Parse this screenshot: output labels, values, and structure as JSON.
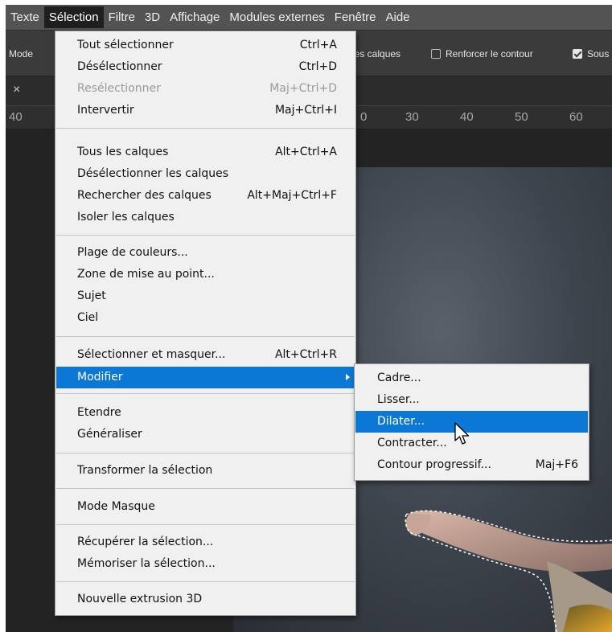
{
  "menubar": {
    "items": [
      {
        "label": "Texte"
      },
      {
        "label": "Sélection"
      },
      {
        "label": "Filtre"
      },
      {
        "label": "3D"
      },
      {
        "label": "Affichage"
      },
      {
        "label": "Modules externes"
      },
      {
        "label": "Fenêtre"
      },
      {
        "label": "Aide"
      }
    ]
  },
  "options": {
    "mode_label": "Mode",
    "calques_label": "les calques",
    "renforcer_label": "Renforcer le contour",
    "renforcer_checked": false,
    "sous_label": "Sous",
    "sous_checked": true
  },
  "tab": {
    "close_glyph": "×"
  },
  "ruler": {
    "left_value": "40",
    "ticks": [
      "0",
      "30",
      "40",
      "50",
      "60"
    ]
  },
  "selection_menu": {
    "items": [
      {
        "label": "Tout sélectionner",
        "shortcut": "Ctrl+A"
      },
      {
        "label": "Désélectionner",
        "shortcut": "Ctrl+D"
      },
      {
        "label": "Resélectionner",
        "shortcut": "Maj+Ctrl+D",
        "disabled": true
      },
      {
        "label": "Intervertir",
        "shortcut": "Maj+Ctrl+I"
      },
      {
        "label": "Tous les calques",
        "shortcut": "Alt+Ctrl+A"
      },
      {
        "label": "Désélectionner les calques",
        "shortcut": ""
      },
      {
        "label": "Rechercher des calques",
        "shortcut": "Alt+Maj+Ctrl+F"
      },
      {
        "label": "Isoler les calques",
        "shortcut": ""
      },
      {
        "label": "Plage de couleurs...",
        "shortcut": ""
      },
      {
        "label": "Zone de mise au point...",
        "shortcut": ""
      },
      {
        "label": "Sujet",
        "shortcut": ""
      },
      {
        "label": "Ciel",
        "shortcut": ""
      },
      {
        "label": "Sélectionner et masquer...",
        "shortcut": "Alt+Ctrl+R"
      },
      {
        "label": "Modifier",
        "shortcut": "",
        "submenu": true,
        "highlighted": true
      },
      {
        "label": "Etendre",
        "shortcut": ""
      },
      {
        "label": "Généraliser",
        "shortcut": ""
      },
      {
        "label": "Transformer la sélection",
        "shortcut": ""
      },
      {
        "label": "Mode Masque",
        "shortcut": ""
      },
      {
        "label": "Récupérer la sélection...",
        "shortcut": ""
      },
      {
        "label": "Mémoriser la sélection...",
        "shortcut": ""
      },
      {
        "label": "Nouvelle extrusion 3D",
        "shortcut": ""
      }
    ]
  },
  "modify_submenu": {
    "items": [
      {
        "label": "Cadre...",
        "shortcut": ""
      },
      {
        "label": "Lisser...",
        "shortcut": ""
      },
      {
        "label": "Dilater...",
        "shortcut": "",
        "highlighted": true
      },
      {
        "label": "Contracter...",
        "shortcut": ""
      },
      {
        "label": "Contour progressif...",
        "shortcut": "Maj+F6"
      }
    ]
  },
  "colors": {
    "highlight": "#0a78d4",
    "menu_bg": "#f0f0f0",
    "menubar_bg": "#535353",
    "canvas_bg": "#232323"
  },
  "cursor_icon": "arrow-pointer-icon"
}
